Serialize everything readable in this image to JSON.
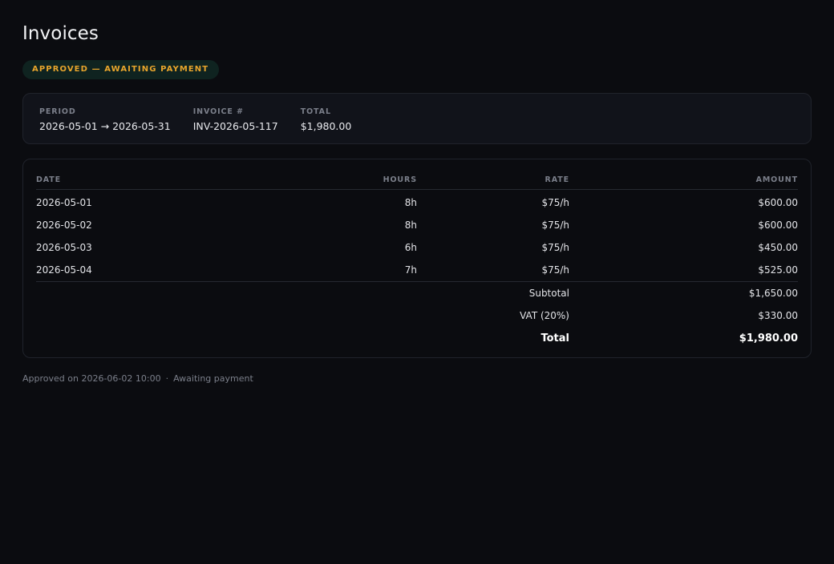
{
  "page": {
    "title": "Invoices"
  },
  "status": {
    "label": "APPROVED — AWAITING PAYMENT",
    "color": "#e7a42c"
  },
  "summary": {
    "period_label": "PERIOD",
    "period_value": "2026-05-01 → 2026-05-31",
    "invoice_label": "INVOICE #",
    "invoice_value": "INV-2026-05-117",
    "total_label": "TOTAL",
    "total_value": "$1,980.00"
  },
  "table": {
    "headers": {
      "date": "DATE",
      "hours": "HOURS",
      "rate": "RATE",
      "amount": "AMOUNT"
    },
    "rows": [
      {
        "date": "2026-05-01",
        "hours": "8h",
        "rate": "$75/h",
        "amount": "$600.00"
      },
      {
        "date": "2026-05-02",
        "hours": "8h",
        "rate": "$75/h",
        "amount": "$600.00"
      },
      {
        "date": "2026-05-03",
        "hours": "6h",
        "rate": "$75/h",
        "amount": "$450.00"
      },
      {
        "date": "2026-05-04",
        "hours": "7h",
        "rate": "$75/h",
        "amount": "$525.00"
      }
    ],
    "subtotal_label": "Subtotal",
    "subtotal_value": "$1,650.00",
    "vat_label": "VAT (20%)",
    "vat_value": "$330.00",
    "total_label": "Total",
    "total_value": "$1,980.00"
  },
  "footer": {
    "approved": "Approved on 2026-06-02 10:00",
    "separator": "·",
    "status": "Awaiting payment"
  }
}
